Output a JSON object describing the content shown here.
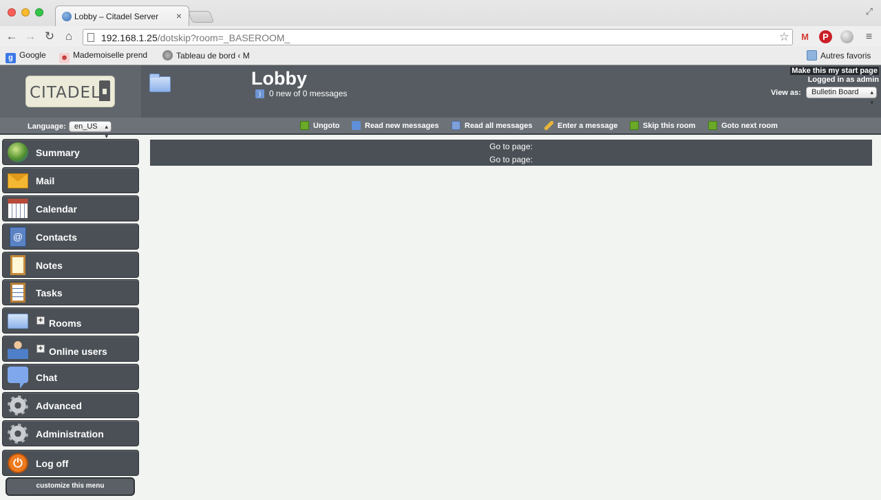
{
  "browser": {
    "tab_title": "Lobby – Citadel Server",
    "url_host": "192.168.1.25",
    "url_path": "/dotskip?room=_BASEROOM_",
    "bookmarks": [
      {
        "label": "Google",
        "icon": "google-icon"
      },
      {
        "label": "Mademoiselle prend",
        "icon": "mademoiselle-icon"
      },
      {
        "label": "Tableau de bord ‹ M",
        "icon": "wordpress-icon"
      }
    ],
    "other_bookmarks": "Autres favoris"
  },
  "header": {
    "logo_text": "CITADEL",
    "room_title": "Lobby",
    "message_count": "0 new of 0 messages",
    "start_page_link": "Make this my start page",
    "logged_in": "Logged in as admin",
    "view_as_label": "View as:",
    "view_as_value": "Bulletin Board"
  },
  "actionbar": {
    "language_label": "Language:",
    "language_value": "en_US",
    "actions": [
      {
        "label": "Ungoto",
        "icon": "ungoto-icon"
      },
      {
        "label": "Read new messages",
        "icon": "refresh-icon"
      },
      {
        "label": "Read all messages",
        "icon": "read-all-icon"
      },
      {
        "label": "Enter a message",
        "icon": "pencil-icon"
      },
      {
        "label": "Skip this room",
        "icon": "skip-icon"
      },
      {
        "label": "Goto next room",
        "icon": "goto-icon"
      }
    ]
  },
  "menu": {
    "items": [
      {
        "label": "Summary",
        "icon": "globe-icon"
      },
      {
        "label": "Mail",
        "icon": "envelope-icon"
      },
      {
        "label": "Calendar",
        "icon": "calendar-icon"
      },
      {
        "label": "Contacts",
        "icon": "address-book-icon"
      },
      {
        "label": "Notes",
        "icon": "notes-icon"
      },
      {
        "label": "Tasks",
        "icon": "tasks-icon"
      },
      {
        "label": "Rooms",
        "icon": "folder-icon"
      },
      {
        "label": "Online users",
        "icon": "user-icon"
      },
      {
        "label": "Chat",
        "icon": "chat-bubble-icon"
      },
      {
        "label": "Advanced",
        "icon": "gear-icon"
      },
      {
        "label": "Administration",
        "icon": "gear-icon"
      },
      {
        "label": "Log off",
        "icon": "power-icon"
      }
    ],
    "customize_label": "customize this menu"
  },
  "main": {
    "pager_top": "Go to page:",
    "pager_bottom": "Go to page:"
  }
}
